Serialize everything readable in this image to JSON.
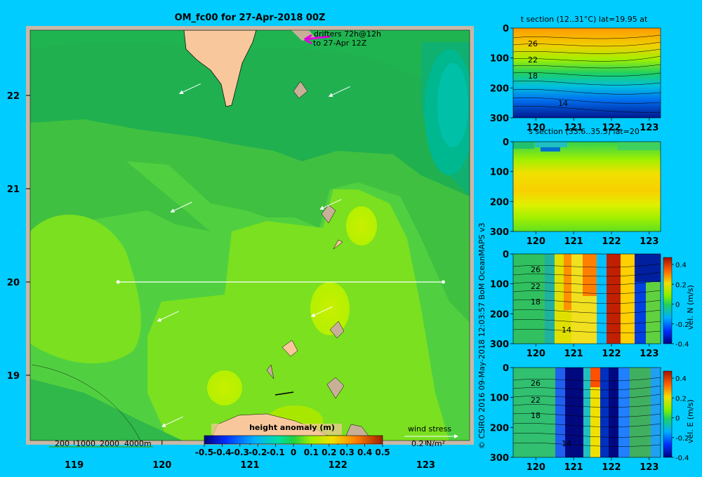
{
  "title": "OM_fc00 for 27-Apr-2018 00Z",
  "drifters": {
    "line1": "drifters 72h@12h",
    "line2": "to 27-Apr 12Z"
  },
  "depth_legend": [
    "200",
    "1000",
    "2000",
    "4000m"
  ],
  "wind_stress": {
    "label": "wind stress",
    "scale": "0.2 N/m²"
  },
  "credit": "© CSIRO 2016   09-May-2018 12:03:57 BoM OceanMAPS v3",
  "colors": {
    "background": "#00ccff",
    "land": "#f8c89c",
    "shallow": "#c8b098",
    "frame": "#c8b8a8"
  },
  "chart_data": [
    {
      "type": "heatmap",
      "title": "OM_fc00 for 27-Apr-2018 00Z",
      "x_ticks": [
        119,
        120,
        121,
        122,
        123
      ],
      "y_ticks": [
        19,
        20,
        21,
        22
      ],
      "xlim": [
        118.5,
        123.5
      ],
      "ylim": [
        18.3,
        22.7
      ],
      "colorbar": {
        "label": "height anomaly  (m)",
        "ticks": [
          "-0.5",
          "-0.4",
          "-0.3",
          "-0.2",
          "-0.1",
          "0",
          "0.1",
          "0.2",
          "0.3",
          "0.4",
          "0.5"
        ],
        "range": [
          -0.5,
          0.5
        ]
      },
      "section_line": {
        "lat": 20,
        "lon_from": 119.5,
        "lon_to": 123.2
      },
      "wind_vectors": [
        {
          "lon": 120.2,
          "lat": 22.02
        },
        {
          "lon": 121.9,
          "lat": 21.99
        },
        {
          "lon": 120.1,
          "lat": 20.75
        },
        {
          "lon": 121.8,
          "lat": 20.78
        },
        {
          "lon": 119.95,
          "lat": 19.58
        },
        {
          "lon": 121.7,
          "lat": 19.63
        },
        {
          "lon": 120.0,
          "lat": 18.45
        }
      ]
    },
    {
      "type": "heatmap",
      "title": "t section (12..31°C) lat=19.95 at",
      "x_ticks": [
        "120",
        "121",
        "122",
        "123"
      ],
      "y_ticks": [
        "0",
        "100",
        "200",
        "300"
      ],
      "contour_labels": [
        "26",
        "22",
        "18",
        "14"
      ]
    },
    {
      "type": "heatmap",
      "title": "s section (33.6..35.5) lat=20",
      "x_ticks": [
        "120",
        "121",
        "122",
        "123"
      ],
      "y_ticks": [
        "0",
        "100",
        "200",
        "300"
      ]
    },
    {
      "type": "heatmap",
      "title": "",
      "x_ticks": [
        "120",
        "121",
        "122",
        "123"
      ],
      "y_ticks": [
        "0",
        "100",
        "200",
        "300"
      ],
      "contour_labels": [
        "26",
        "22",
        "18",
        "14"
      ],
      "colorbar": {
        "label": "vel. N  (m/s)",
        "ticks": [
          "0.4",
          "0.2",
          "0",
          "-0.2",
          "-0.4"
        ]
      }
    },
    {
      "type": "heatmap",
      "title": "",
      "x_ticks": [
        "120",
        "121",
        "122",
        "123"
      ],
      "y_ticks": [
        "0",
        "100",
        "200",
        "300"
      ],
      "contour_labels": [
        "26",
        "22",
        "18",
        "14"
      ],
      "colorbar": {
        "label": "vel. E  (m/s)",
        "ticks": [
          "0.4",
          "0.2",
          "0",
          "-0.2",
          "-0.4"
        ]
      }
    }
  ]
}
